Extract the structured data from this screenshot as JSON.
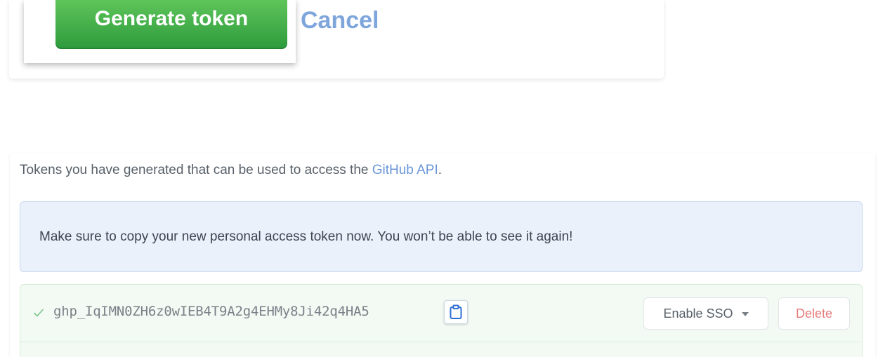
{
  "top": {
    "generate_label": "Generate token",
    "cancel_label": "Cancel"
  },
  "tokens": {
    "intro_prefix": "Tokens you have generated that can be used to access the ",
    "intro_link": "GitHub API",
    "intro_suffix": ".",
    "notice": "Make sure to copy your new personal access token now. You won’t be able to see it again!",
    "token_value": "ghp_IqIMN0ZH6z0wIEB4T9A2g4EHMy8Ji42q4HA5",
    "enable_sso_label": "Enable SSO",
    "delete_label": "Delete"
  },
  "icons": {
    "check": "check-icon",
    "copy": "clipboard-icon",
    "caret": "caret-down-icon"
  },
  "colors": {
    "primary_green": "#2c9a3c",
    "link_blue": "#6b96d8",
    "danger_red": "#e57b7b",
    "flash_bg": "#eaf1fb",
    "token_bg": "#f3faf3"
  }
}
